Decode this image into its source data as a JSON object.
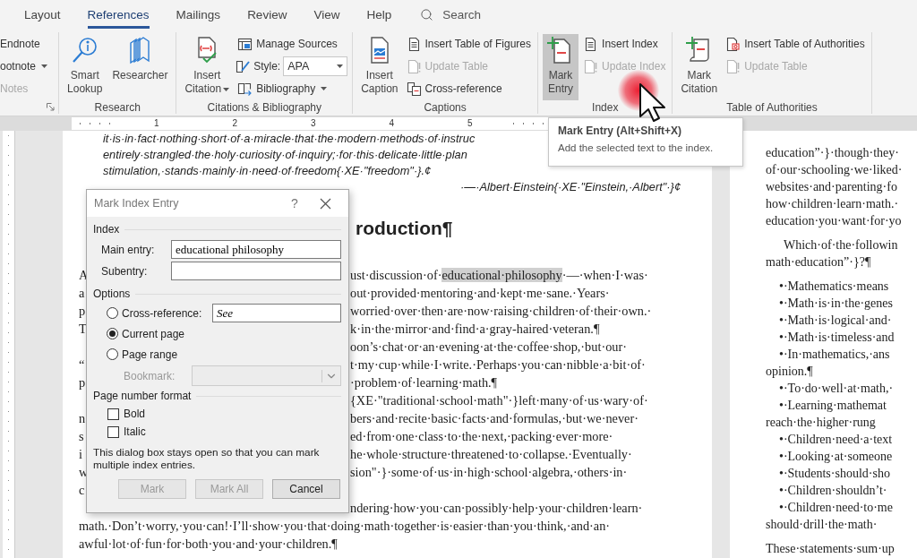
{
  "tabs": [
    {
      "label": "Layout",
      "selected": false
    },
    {
      "label": "References",
      "selected": true
    },
    {
      "label": "Mailings",
      "selected": false
    },
    {
      "label": "Review",
      "selected": false
    },
    {
      "label": "View",
      "selected": false
    },
    {
      "label": "Help",
      "selected": false
    }
  ],
  "search": {
    "label": "Search"
  },
  "ribbon": {
    "groups": [
      {
        "columns": [
          {
            "items": [
              {
                "kind": "small",
                "label": "Endnote",
                "disabled": false,
                "pressed": false
              },
              {
                "kind": "small",
                "label": "ootnote",
                "dropdown": true,
                "disabled": false,
                "pressed": false
              },
              {
                "kind": "small",
                "label": "Notes",
                "disabled": true,
                "pressed": false
              }
            ]
          }
        ]
      },
      {
        "label": "Research",
        "columns": [
          {
            "items": [
              {
                "kind": "large",
                "lines": [
                  "Smart",
                  "Lookup"
                ],
                "disabled": false,
                "pressed": false
              }
            ]
          },
          {
            "items": [
              {
                "kind": "large",
                "lines": [
                  "Researcher"
                ],
                "disabled": false,
                "pressed": false
              }
            ]
          }
        ]
      },
      {
        "label": "Citations & Bibliography",
        "columns": [
          {
            "items": [
              {
                "kind": "large",
                "lines": [
                  "Insert",
                  "Citation"
                ],
                "dropdown": true,
                "disabled": false,
                "pressed": false
              }
            ]
          },
          {
            "items": [
              {
                "kind": "small",
                "label": "Manage Sources",
                "disabled": false,
                "pressed": false
              },
              {
                "kind": "select",
                "label": "Style:",
                "value": "APA",
                "disabled": false,
                "pressed": false
              },
              {
                "kind": "small",
                "label": "Bibliography",
                "dropdown": true,
                "disabled": false,
                "pressed": false
              }
            ]
          }
        ]
      },
      {
        "label": "Captions",
        "columns": [
          {
            "items": [
              {
                "kind": "large",
                "lines": [
                  "Insert",
                  "Caption"
                ],
                "disabled": false,
                "pressed": false
              }
            ]
          },
          {
            "items": [
              {
                "kind": "small",
                "label": "Insert Table of Figures",
                "disabled": false,
                "pressed": false
              },
              {
                "kind": "small",
                "label": "Update Table",
                "disabled": true,
                "pressed": false
              },
              {
                "kind": "small",
                "label": "Cross-reference",
                "disabled": false,
                "pressed": false
              }
            ]
          }
        ]
      },
      {
        "label": "Index",
        "columns": [
          {
            "items": [
              {
                "kind": "large",
                "lines": [
                  "Mark",
                  "Entry"
                ],
                "disabled": false,
                "pressed": true
              }
            ]
          },
          {
            "items": [
              {
                "kind": "small",
                "label": "Insert Index",
                "disabled": false,
                "pressed": false
              },
              {
                "kind": "small",
                "label": "Update Index",
                "disabled": true,
                "pressed": false
              }
            ]
          }
        ]
      },
      {
        "label": "Table of Authorities",
        "columns": [
          {
            "items": [
              {
                "kind": "large",
                "lines": [
                  "Mark",
                  "Citation"
                ],
                "disabled": false,
                "pressed": false
              }
            ]
          },
          {
            "items": [
              {
                "kind": "small",
                "label": "Insert Table of Authorities",
                "disabled": false,
                "pressed": false
              },
              {
                "kind": "small",
                "label": "Update Table",
                "disabled": true,
                "pressed": false
              }
            ]
          }
        ]
      }
    ]
  },
  "tooltip": {
    "title": "Mark Entry (Alt+Shift+X)",
    "description": "Add the selected text to the index."
  },
  "ruler_numbers": [
    "1",
    "2",
    "3",
    "4",
    "5"
  ],
  "left_page": {
    "quote_lines": [
      "it·is·in·fact·nothing·short·of·a·miracle·that·the·modern·methods·of·instruc",
      "entirely·strangled·the·holy·curiosity·of·inquiry;·for·this·delicate·little·plan",
      "stimulation,·stands·mainly·in·need·of·freedom{·XE·\"freedom\"·}.¢"
    ],
    "attribution": "·—·Albert·Einstein{·XE·\"Einstein,·Albert\"·}¢",
    "heading": "roduction¶",
    "lines": [
      {
        "left": "A",
        "right": [
          {
            "text": "ust·discussion·of·",
            "highlighted": false
          },
          {
            "text": "educational·philosophy",
            "highlighted": true
          },
          {
            "text": "·—·when·I·was·",
            "highlighted": false
          }
        ]
      },
      {
        "left": "a",
        "right": [
          {
            "text": "out·provided·mentoring·and·kept·me·sane.·Years·",
            "highlighted": false
          }
        ]
      },
      {
        "left": "p",
        "right": [
          {
            "text": "worried·over·then·are·now·raising·children·of·their·own.·",
            "highlighted": false
          }
        ]
      },
      {
        "left": "T",
        "right": [
          {
            "text": "k·in·the·mirror·and·find·a·gray-haired·veteran.¶",
            "highlighted": false
          }
        ]
      },
      {
        "right": [
          {
            "text": "oon’s·chat·or·an·evening·at·the·coffee·shop,·but·our·",
            "highlighted": false
          }
        ]
      },
      {
        "left": "“",
        "right": [
          {
            "text": "t·my·cup·while·I·write.·Perhaps·you·can·nibble·a·bit·of·",
            "highlighted": false
          }
        ]
      },
      {
        "left": "p",
        "right": [
          {
            "text": "·problem·of·learning·math.¶",
            "highlighted": false
          }
        ]
      },
      {
        "right": [
          {
            "text": "{XE·\"traditional·school·math\"·}left·many·of·us·wary·of·",
            "highlighted": false
          }
        ]
      },
      {
        "left": "n",
        "right": [
          {
            "text": "bers·and·recite·basic·facts·and·formulas,·but·we·never·",
            "highlighted": false
          }
        ]
      },
      {
        "left": "s",
        "right": [
          {
            "text": "ed·from·one·class·to·the·next,·packing·ever·more·",
            "highlighted": false
          }
        ]
      },
      {
        "left": "i",
        "right": [
          {
            "text": "he·whole·structure·threatened·to·collapse.·Eventually·",
            "highlighted": false
          }
        ]
      },
      {
        "left": "w",
        "right": [
          {
            "text": "sion\"·}·some·of·us·in·high·school·algebra,·others·in·",
            "highlighted": false
          }
        ]
      },
      {
        "left": "c"
      },
      {
        "right": [
          {
            "text": "ndering·how·you·can·possibly·help·your·children·learn·",
            "highlighted": false
          }
        ]
      },
      {
        "left": "math.·Don’t·worry,·you·can!·I’ll·show·you·that·doing·math·together·is·easier·than·you·think,·and·an·"
      },
      {
        "left": "awful·lot·of·fun·for·both·you·and·your·children.¶"
      }
    ]
  },
  "right_page": {
    "blocks": [
      {
        "lines": [
          {
            "kind": "body",
            "text": "education”·}·though·they·"
          },
          {
            "kind": "body",
            "text": "of·our·schooling·we·liked·"
          },
          {
            "kind": "body",
            "text": "websites·and·parenting·fo"
          },
          {
            "kind": "body",
            "text": "how·children·learn·math.·"
          },
          {
            "kind": "body",
            "text": "education·you·want·for·yo"
          }
        ]
      },
      {
        "lines": [
          {
            "kind": "indent",
            "text": "Which·of·the·followin"
          },
          {
            "kind": "body",
            "text": "math·education”·}?¶"
          }
        ]
      },
      {
        "lines": [
          {
            "kind": "bullet",
            "text": "•·Mathematics·means"
          },
          {
            "kind": "bullet",
            "text": "•·Math·is·in·the·genes"
          },
          {
            "kind": "bullet",
            "text": "•·Math·is·logical·and·"
          },
          {
            "kind": "bullet",
            "text": "•·Math·is·timeless·and"
          },
          {
            "kind": "bullet",
            "text": "•·In·mathematics,·ans"
          },
          {
            "kind": "body",
            "text": "opinion.¶"
          },
          {
            "kind": "bullet",
            "text": "•·To·do·well·at·math,·"
          },
          {
            "kind": "bullet",
            "text": "•·Learning·mathemat"
          },
          {
            "kind": "body",
            "text": "reach·the·higher·rung"
          },
          {
            "kind": "bullet",
            "text": "•·Children·need·a·text"
          },
          {
            "kind": "bullet",
            "text": "•·Looking·at·someone"
          },
          {
            "kind": "bullet",
            "text": "•·Students·should·sho"
          },
          {
            "kind": "bullet",
            "text": "•·Children·shouldn’t·"
          },
          {
            "kind": "bullet",
            "text": "•·Children·need·to·me"
          },
          {
            "kind": "body",
            "text": "should·drill·the·math·"
          }
        ]
      },
      {
        "lines": [
          {
            "kind": "body",
            "text": "These·statements·sum·up"
          }
        ]
      }
    ]
  },
  "dialog": {
    "title": "Mark Index Entry",
    "help": "?",
    "index_heading": "Index",
    "main_entry": {
      "label": "Main entry:",
      "value": "educational philosophy"
    },
    "subentry": {
      "label": "Subentry:"
    },
    "options_heading": "Options",
    "options": [
      {
        "label": "Cross-reference:",
        "selected": false,
        "field_value": "See"
      },
      {
        "label": "Current page",
        "selected": true
      },
      {
        "label": "Page range",
        "selected": false
      }
    ],
    "bookmark": {
      "label": "Bookmark:",
      "disabled": true
    },
    "format_heading": "Page number format",
    "formats": [
      {
        "label": "Bold",
        "checked": false
      },
      {
        "label": "Italic",
        "checked": false
      }
    ],
    "note": "This dialog box stays open so that you can mark multiple index entries.",
    "buttons": [
      {
        "label": "Mark",
        "disabled": true
      },
      {
        "label": "Mark All",
        "disabled": true
      },
      {
        "label": "Cancel",
        "disabled": false
      }
    ]
  }
}
